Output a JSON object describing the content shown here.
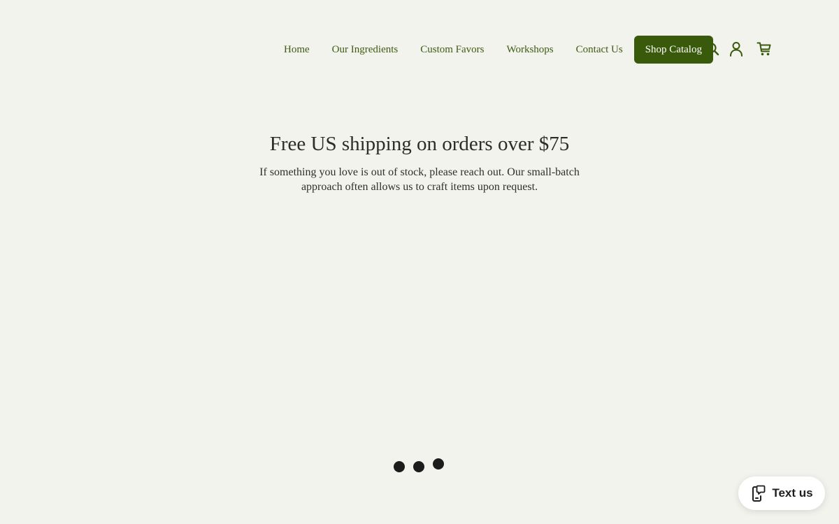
{
  "nav": {
    "links": [
      {
        "label": "Home"
      },
      {
        "label": "Our Ingredients"
      },
      {
        "label": "Custom Favors"
      },
      {
        "label": "Workshops"
      },
      {
        "label": "Contact Us"
      }
    ],
    "cta_label": "Shop Catalog",
    "icons": [
      "search-icon",
      "account-icon",
      "cart-icon"
    ]
  },
  "banner": {
    "title": "Free US shipping on orders over $75",
    "text": "If something you love is out of stock, please reach out. Our small-batch approach often allows us to craft items upon request."
  },
  "loader": {
    "dots": 3
  },
  "chat_widget": {
    "label": "Text us",
    "icon": "phone-chat-icon"
  },
  "colors": {
    "background": "#f3f3ee",
    "accent": "#3a5a0b",
    "nav_text": "#3d5a12",
    "heading_text": "#2a2f24"
  }
}
